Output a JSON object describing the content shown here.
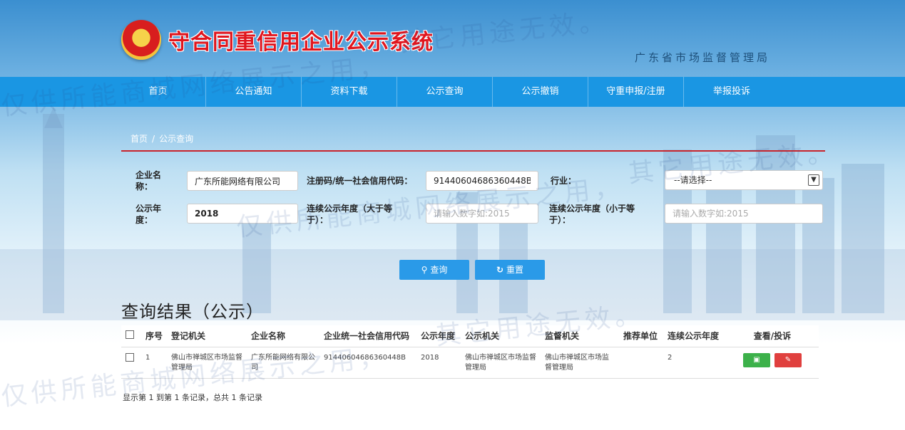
{
  "header": {
    "site_title": "守合同重信用企业公示系统",
    "bureau": "广东省市场监督管理局"
  },
  "nav": {
    "items": [
      "首页",
      "公告通知",
      "资料下载",
      "公示查询",
      "公示撤销",
      "守重申报/注册",
      "举报投诉"
    ]
  },
  "breadcrumb": {
    "home": "首页",
    "sep": "/",
    "current": "公示查询"
  },
  "form": {
    "company_name_label": "企业名称：",
    "company_name_value": "广东所能网络有限公司",
    "credit_code_label": "注册码/统一社会信用代码：",
    "credit_code_value": "91440604686360448B",
    "industry_label": "行业：",
    "industry_value": "--请选择--",
    "year_label": "公示年度：",
    "year_value": "2018",
    "years_gte_label": "连续公示年度（大于等于）：",
    "years_gte_placeholder": "请输入数字如:2015",
    "years_lte_label": "连续公示年度（小于等于）：",
    "years_lte_placeholder": "请输入数字如:2015"
  },
  "buttons": {
    "search": "查询",
    "reset": "重置"
  },
  "results": {
    "title": "查询结果（公示）",
    "columns": [
      "序号",
      "登记机关",
      "企业名称",
      "企业统一社会信用代码",
      "公示年度",
      "公示机关",
      "监督机关",
      "推荐单位",
      "连续公示年度",
      "查看/投诉"
    ],
    "rows": [
      {
        "index": "1",
        "reg_org": "佛山市禅城区市场监督管理局",
        "company": "广东所能网络有限公司",
        "code": "91440604686360448B",
        "year": "2018",
        "pub_org": "佛山市禅城区市场监督管理局",
        "sup_org": "佛山市禅城区市场监督管理局",
        "recommender": "",
        "years": "2"
      }
    ],
    "pager": "显示第 1 到第 1 条记录，总共 1 条记录"
  },
  "watermark": {
    "line1": "其它用途无效。",
    "line2": "仅供所能商城网络展示之用，",
    "line3": "其它用途无效。",
    "line4": "仅供所能商城网络展示之用，",
    "line5": "其它用途无效。",
    "line6": "仅供所能商城网络展示之用，"
  },
  "colors": {
    "nav": "#1a96e3",
    "title_red": "#e0161e",
    "button": "#2a9ae8",
    "view": "#3cb14a",
    "complain": "#e0403e"
  }
}
